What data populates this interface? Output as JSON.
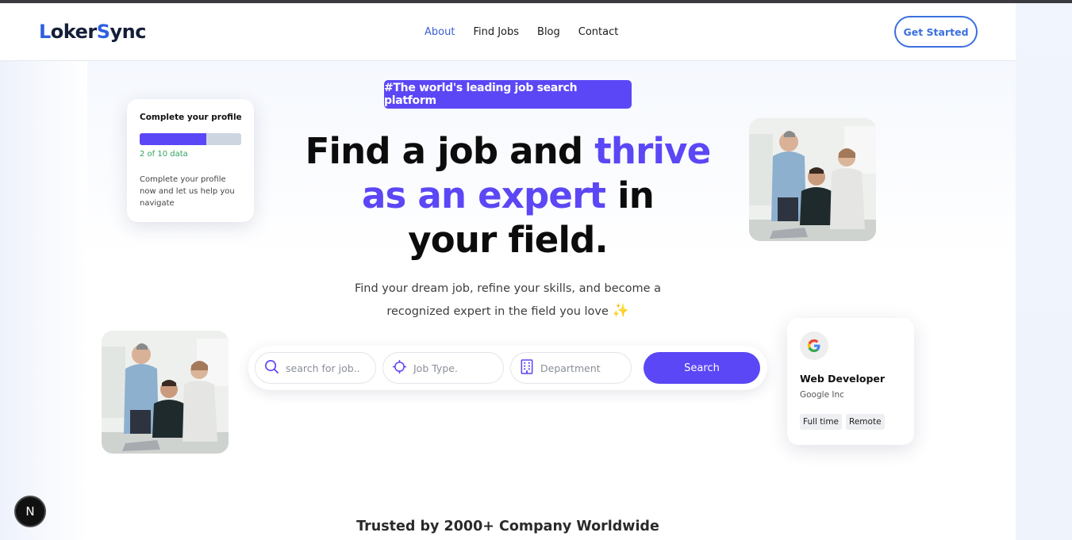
{
  "nav": {
    "logo_first": "L",
    "logo_mid": "oker",
    "logo_s": "S",
    "logo_end": "ync",
    "links": [
      "About",
      "Find Jobs",
      "Blog",
      "Contact"
    ],
    "cta_label": "Get Started"
  },
  "hero": {
    "badge": "#The world's leading job search platform",
    "headline_1": "Find a job and ",
    "headline_2": "thrive",
    "headline_3": "as an expert",
    "headline_4": " in",
    "headline_5": "your field.",
    "subtext": "Find your dream job, refine your skills, and become a recognized expert in the field you love",
    "sparkle": "✨"
  },
  "profile_card": {
    "title": "Complete your profile",
    "progress_fraction": 0.66,
    "count": "2 of 10 data",
    "description": "Complete your profile now and let us help you navigate"
  },
  "search": {
    "job_placeholder": "search for job..",
    "type_placeholder": "Job Type.",
    "department_placeholder": "Department",
    "button_label": "Search"
  },
  "job_card": {
    "logo_letter": "G",
    "title": "Web Developer",
    "company": "Google Inc",
    "tags": [
      "Full time",
      "Remote"
    ]
  },
  "trusted_heading": "Trusted by 2000+ Company Worldwide",
  "dev_badge": "N",
  "colors": {
    "accent": "#5b47f5",
    "brand_blue": "#3b6fe0",
    "progress_green": "#2fa25a"
  }
}
